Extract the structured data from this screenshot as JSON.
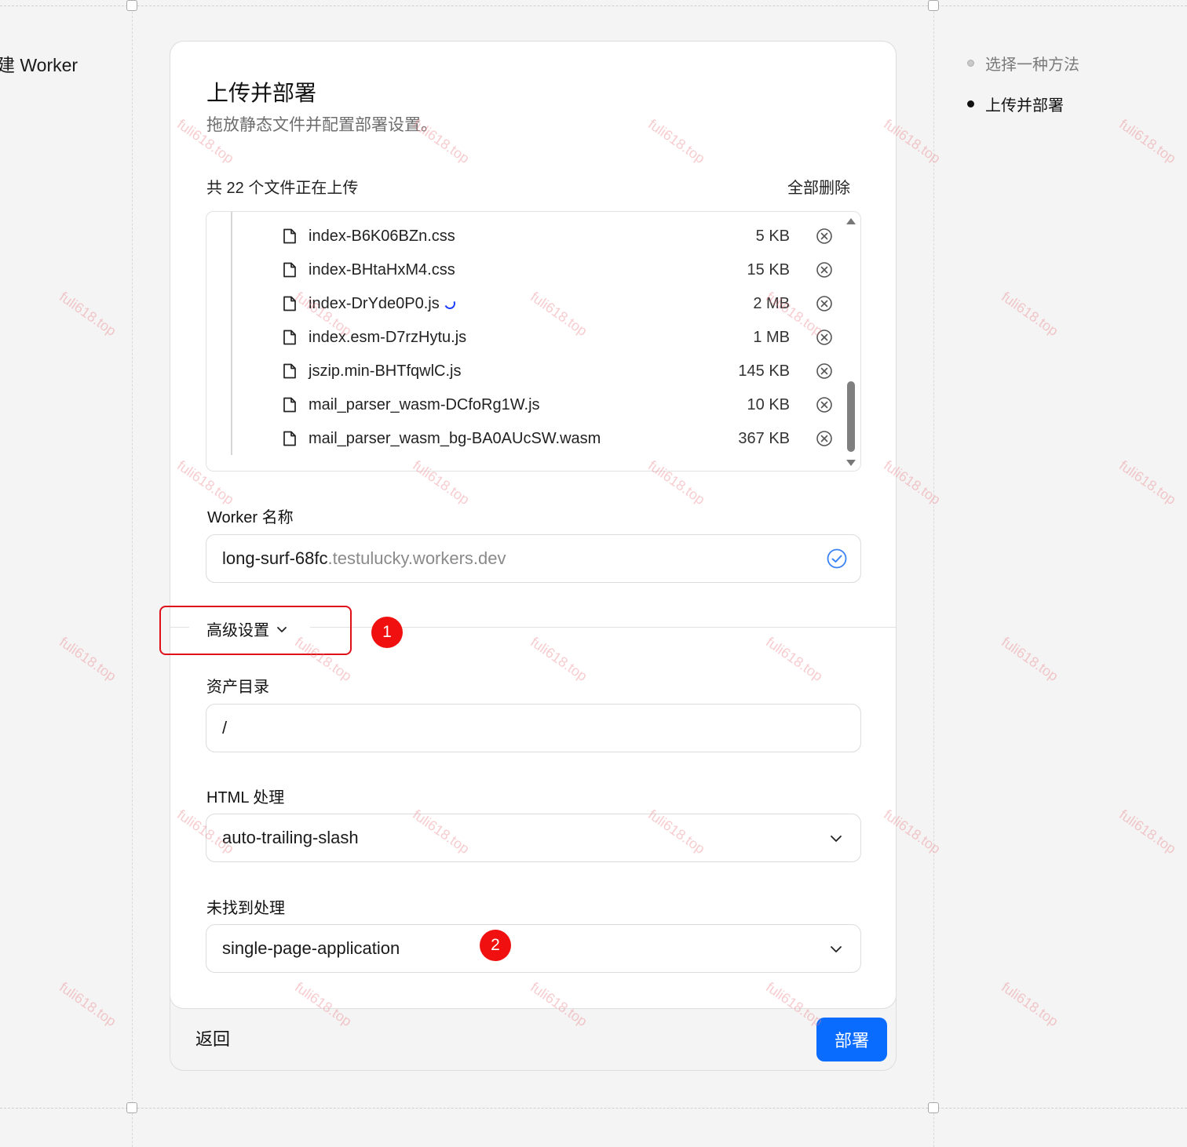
{
  "page": {
    "left_title": "建 Worker"
  },
  "steps": [
    {
      "label": "选择一种方法",
      "state": "inactive"
    },
    {
      "label": "上传并部署",
      "state": "active"
    }
  ],
  "card": {
    "title": "上传并部署",
    "subtitle": "拖放静态文件并配置部署设置。",
    "upload_count": "共 22 个文件正在上传",
    "remove_all": "全部删除"
  },
  "files": [
    {
      "name": "index-B6K06BZn.css",
      "size": "5 KB",
      "uploading": false
    },
    {
      "name": "index-BHtaHxM4.css",
      "size": "15 KB",
      "uploading": false
    },
    {
      "name": "index-DrYde0P0.js",
      "size": "2 MB",
      "uploading": true
    },
    {
      "name": "index.esm-D7rzHytu.js",
      "size": "1 MB",
      "uploading": false
    },
    {
      "name": "jszip.min-BHTfqwlC.js",
      "size": "145 KB",
      "uploading": false
    },
    {
      "name": "mail_parser_wasm-DCfoRg1W.js",
      "size": "10 KB",
      "uploading": false
    },
    {
      "name": "mail_parser_wasm_bg-BA0AUcSW.wasm",
      "size": "367 KB",
      "uploading": false
    }
  ],
  "worker_name": {
    "label": "Worker 名称",
    "value": "long-surf-68fc",
    "suffix": ".testulucky.workers.dev"
  },
  "advanced": {
    "toggle_label": "高级设置"
  },
  "assets_dir": {
    "label": "资产目录",
    "value": "/"
  },
  "html_handling": {
    "label": "HTML 处理",
    "value": "auto-trailing-slash"
  },
  "not_found_handling": {
    "label": "未找到处理",
    "value": "single-page-application"
  },
  "annotations": {
    "badge1": "1",
    "badge2": "2"
  },
  "footer": {
    "back_label": "返回",
    "deploy_label": "部署"
  },
  "watermark": "fuli618.top",
  "colors": {
    "accent": "#0a6cff",
    "annotation": "#e0101a",
    "verified": "#3b82f6"
  }
}
